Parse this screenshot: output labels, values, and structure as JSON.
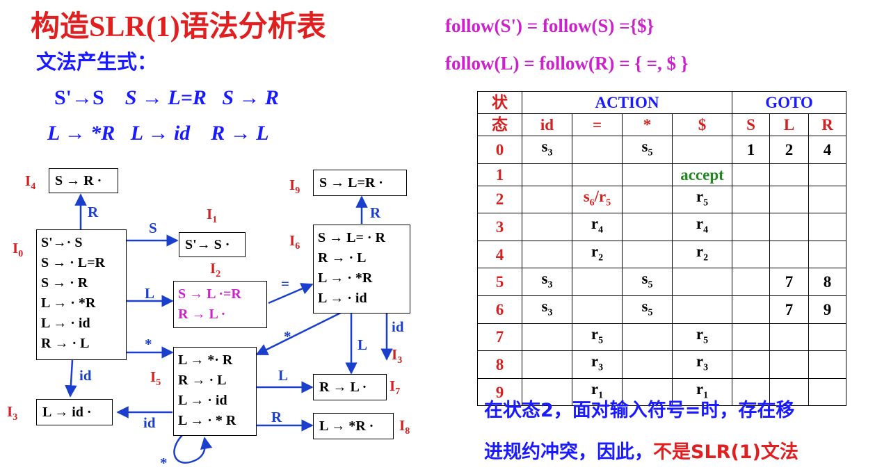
{
  "header": {
    "title": "构造SLR(1)语法分析表",
    "subtitle": "文法产生式："
  },
  "productions": {
    "line1": [
      "S'→S",
      "S → L=R",
      "S → R"
    ],
    "line2": [
      "L → *R",
      "L → id",
      "R → L"
    ]
  },
  "follow": {
    "line1": "follow(S') = follow(S) ={$}",
    "line2": "follow(L) =  follow(R) = { =, $ }"
  },
  "diagram": {
    "states": {
      "I0": {
        "label": "I",
        "sub": "0",
        "items": [
          "S'→· S",
          "S → · L=R",
          "S → · R",
          "L → · *R",
          "L → · id",
          "R → · L"
        ]
      },
      "I1": {
        "label": "I",
        "sub": "1",
        "items": [
          "S'→ S ·"
        ]
      },
      "I2": {
        "label": "I",
        "sub": "2",
        "items": [
          "S → L ·=R",
          "R → L ·"
        ]
      },
      "I3": {
        "label": "I",
        "sub": "3",
        "items": [
          "L → id ·"
        ]
      },
      "I3b": {
        "label": "I",
        "sub": "3"
      },
      "I4": {
        "label": "I",
        "sub": "4",
        "items": [
          "S → R ·"
        ]
      },
      "I5": {
        "label": "I",
        "sub": "5",
        "items": [
          "L → *· R",
          "R → · L",
          "L → · id",
          "L → · * R"
        ]
      },
      "I6": {
        "label": "I",
        "sub": "6",
        "items": [
          "S → L= · R",
          "R → · L",
          "L → · *R",
          "L → · id"
        ]
      },
      "I7": {
        "label": "I",
        "sub": "7",
        "items": [
          "R → L ·"
        ]
      },
      "I8": {
        "label": "I",
        "sub": "8",
        "items": [
          "L → *R ·"
        ]
      },
      "I9": {
        "label": "I",
        "sub": "9",
        "items": [
          "S → L=R ·"
        ]
      }
    },
    "edges": {
      "e0_4": "R",
      "e0_1": "S",
      "e0_2": "L",
      "e0_5": "*",
      "e0_3": "id",
      "e2_6": "=",
      "e6_9": "R",
      "e6_5": "*",
      "e6_7": "L",
      "e6_3": "id",
      "e5_7": "L",
      "e5_8": "R",
      "e5_3": "id",
      "e5_5": "*"
    }
  },
  "table": {
    "state_header": [
      "状",
      "态"
    ],
    "action_header": "ACTION",
    "goto_header": "GOTO",
    "action_cols": [
      "id",
      "=",
      "*",
      "$"
    ],
    "goto_cols": [
      "S",
      "L",
      "R"
    ],
    "rows": [
      {
        "state": "0",
        "id": [
          "s",
          "3"
        ],
        "eq": null,
        "star": [
          "s",
          "5"
        ],
        "dollar": null,
        "S": "1",
        "L": "2",
        "R": "4"
      },
      {
        "state": "1",
        "id": null,
        "eq": null,
        "star": null,
        "dollar": "accept",
        "S": "",
        "L": "",
        "R": ""
      },
      {
        "state": "2",
        "id": null,
        "eq": [
          "s",
          "6",
          "/r",
          "5"
        ],
        "star": null,
        "dollar": [
          "r",
          "5"
        ],
        "S": "",
        "L": "",
        "R": ""
      },
      {
        "state": "3",
        "id": null,
        "eq": [
          "r",
          "4"
        ],
        "star": null,
        "dollar": [
          "r",
          "4"
        ],
        "S": "",
        "L": "",
        "R": ""
      },
      {
        "state": "4",
        "id": null,
        "eq": [
          "r",
          "2"
        ],
        "star": null,
        "dollar": [
          "r",
          "2"
        ],
        "S": "",
        "L": "",
        "R": ""
      },
      {
        "state": "5",
        "id": [
          "s",
          "3"
        ],
        "eq": null,
        "star": [
          "s",
          "5"
        ],
        "dollar": null,
        "S": "",
        "L": "7",
        "R": "8"
      },
      {
        "state": "6",
        "id": [
          "s",
          "3"
        ],
        "eq": null,
        "star": [
          "s",
          "5"
        ],
        "dollar": null,
        "S": "",
        "L": "7",
        "R": "9"
      },
      {
        "state": "7",
        "id": null,
        "eq": [
          "r",
          "5"
        ],
        "star": null,
        "dollar": [
          "r",
          "5"
        ],
        "S": "",
        "L": "",
        "R": ""
      },
      {
        "state": "8",
        "id": null,
        "eq": [
          "r",
          "3"
        ],
        "star": null,
        "dollar": [
          "r",
          "3"
        ],
        "S": "",
        "L": "",
        "R": ""
      },
      {
        "state": "9",
        "id": null,
        "eq": [
          "r",
          "1"
        ],
        "star": null,
        "dollar": [
          "r",
          "1"
        ],
        "S": "",
        "L": "",
        "R": ""
      }
    ]
  },
  "note": {
    "line1": "在状态2，面对输入符号=时，存在移",
    "line2_a": "进规约冲突，因此，",
    "line2_b": "不是SLR(1)文法"
  },
  "colors": {
    "title": "#e02020",
    "blue": "#1a1aff",
    "magenta": "#cc22cc",
    "edge": "#1a3fcc",
    "accept": "#228822"
  }
}
